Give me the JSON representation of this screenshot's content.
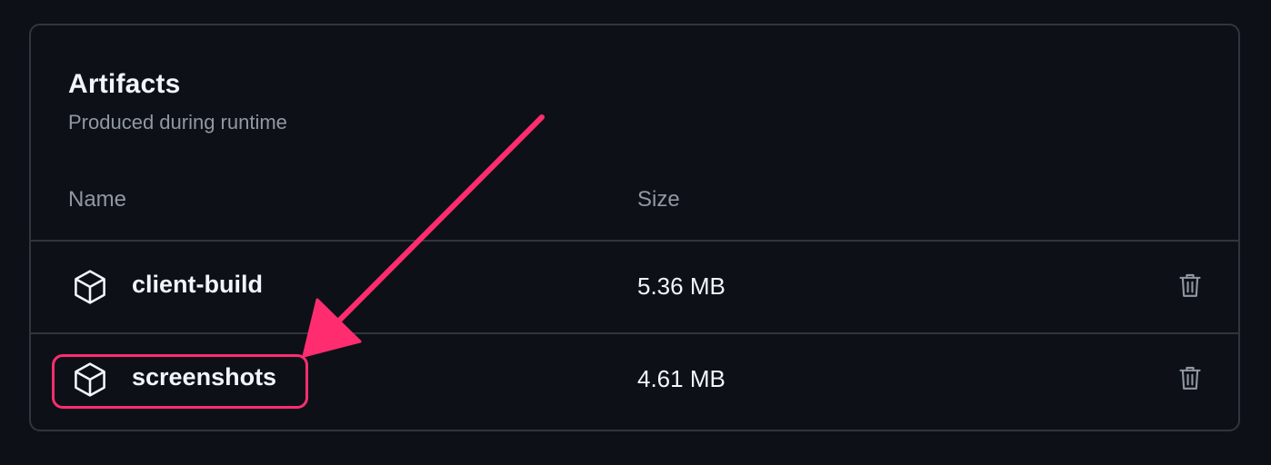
{
  "artifacts_panel": {
    "title": "Artifacts",
    "subtitle": "Produced during runtime",
    "columns": {
      "name": "Name",
      "size": "Size"
    },
    "rows": [
      {
        "name": "client-build",
        "size": "5.36 MB",
        "icon": "package-icon",
        "action_icon": "trash-icon"
      },
      {
        "name": "screenshots",
        "size": "4.61 MB",
        "icon": "package-icon",
        "action_icon": "trash-icon"
      }
    ]
  },
  "annotation": {
    "color": "#ff2d6f",
    "highlighted_row": "screenshots",
    "shape": "arrow-and-rounded-box"
  },
  "colors": {
    "background": "#0d1117",
    "border": "#30363d",
    "text_primary": "#f0f6fc",
    "text_muted": "#9198a1"
  }
}
